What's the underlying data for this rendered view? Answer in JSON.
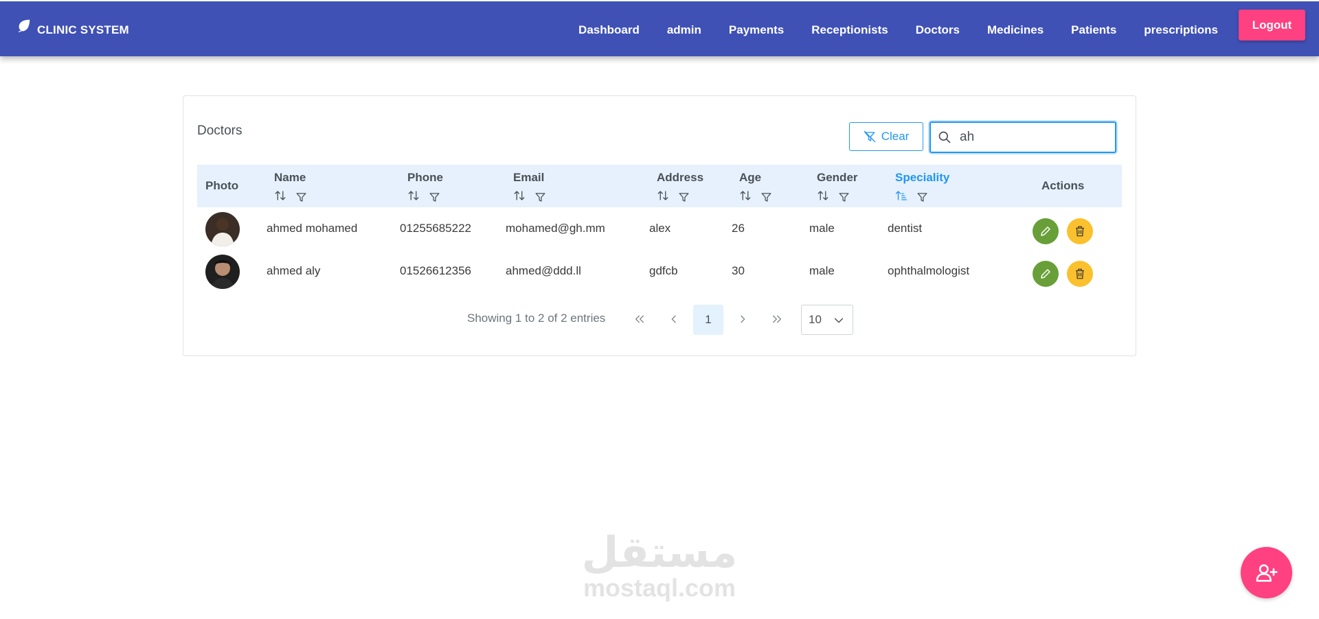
{
  "navbar": {
    "brand": "CLINIC SYSTEM",
    "brand_icon": "leaf-icon",
    "links": [
      "Dashboard",
      "admin",
      "Payments",
      "Receptionists",
      "Doctors",
      "Medicines",
      "Patients",
      "prescriptions"
    ],
    "logout": "Logout",
    "color": "#3f51b5",
    "logout_color": "#ff4081"
  },
  "card": {
    "title": "Doctors",
    "clear_label": "Clear",
    "search_value": "ah"
  },
  "table": {
    "columns": [
      "Photo",
      "Name",
      "Phone",
      "Email",
      "Address",
      "Age",
      "Gender",
      "Speciality",
      "Actions"
    ],
    "sorted_column": "Speciality",
    "rows": [
      {
        "photo": "avatar",
        "name": "ahmed mohamed",
        "phone": "01255685222",
        "email": "mohamed@gh.mm",
        "address": "alex",
        "age": "26",
        "gender": "male",
        "speciality": "dentist"
      },
      {
        "photo": "avatar",
        "name": "ahmed aly",
        "phone": "01526612356",
        "email": "ahmed@ddd.ll",
        "address": "gdfcb",
        "age": "30",
        "gender": "male",
        "speciality": "ophthalmologist"
      }
    ],
    "edit_color": "#689f38",
    "delete_color": "#fbc02d"
  },
  "paginator": {
    "report": "Showing 1 to 2 of 2 entries",
    "current_page": "1",
    "rows_per_page": "10"
  },
  "watermark": {
    "arabic": "مستقل",
    "latin": "mostaql.com"
  },
  "fab": {
    "icon": "user-plus-icon"
  }
}
